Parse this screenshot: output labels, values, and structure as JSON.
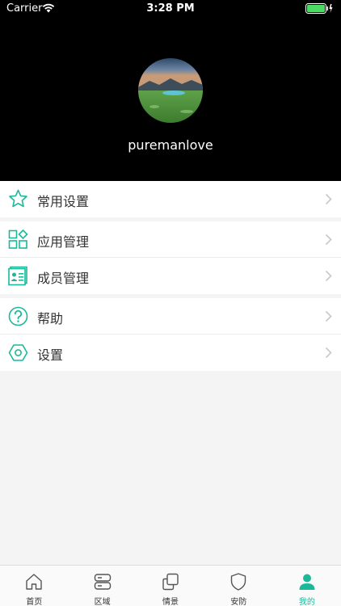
{
  "status_bar": {
    "carrier": "Carrier",
    "time": "3:28 PM"
  },
  "profile": {
    "username": "puremanlove"
  },
  "menu": {
    "favorites": {
      "label": "常用设置",
      "icon": "star-icon"
    },
    "app_manage": {
      "label": "应用管理",
      "icon": "apps-grid-icon"
    },
    "member_manage": {
      "label": "成员管理",
      "icon": "contact-card-icon"
    },
    "help": {
      "label": "帮助",
      "icon": "question-circle-icon"
    },
    "settings": {
      "label": "设置",
      "icon": "hexagon-settings-icon"
    }
  },
  "tabs": [
    {
      "label": "首页",
      "icon": "home-icon"
    },
    {
      "label": "区域",
      "icon": "area-icon"
    },
    {
      "label": "情景",
      "icon": "scene-icon"
    },
    {
      "label": "安防",
      "icon": "shield-icon"
    },
    {
      "label": "我的",
      "icon": "person-icon",
      "active": true
    }
  ],
  "colors": {
    "accent": "#1bb99a",
    "header_bg": "#000000"
  }
}
